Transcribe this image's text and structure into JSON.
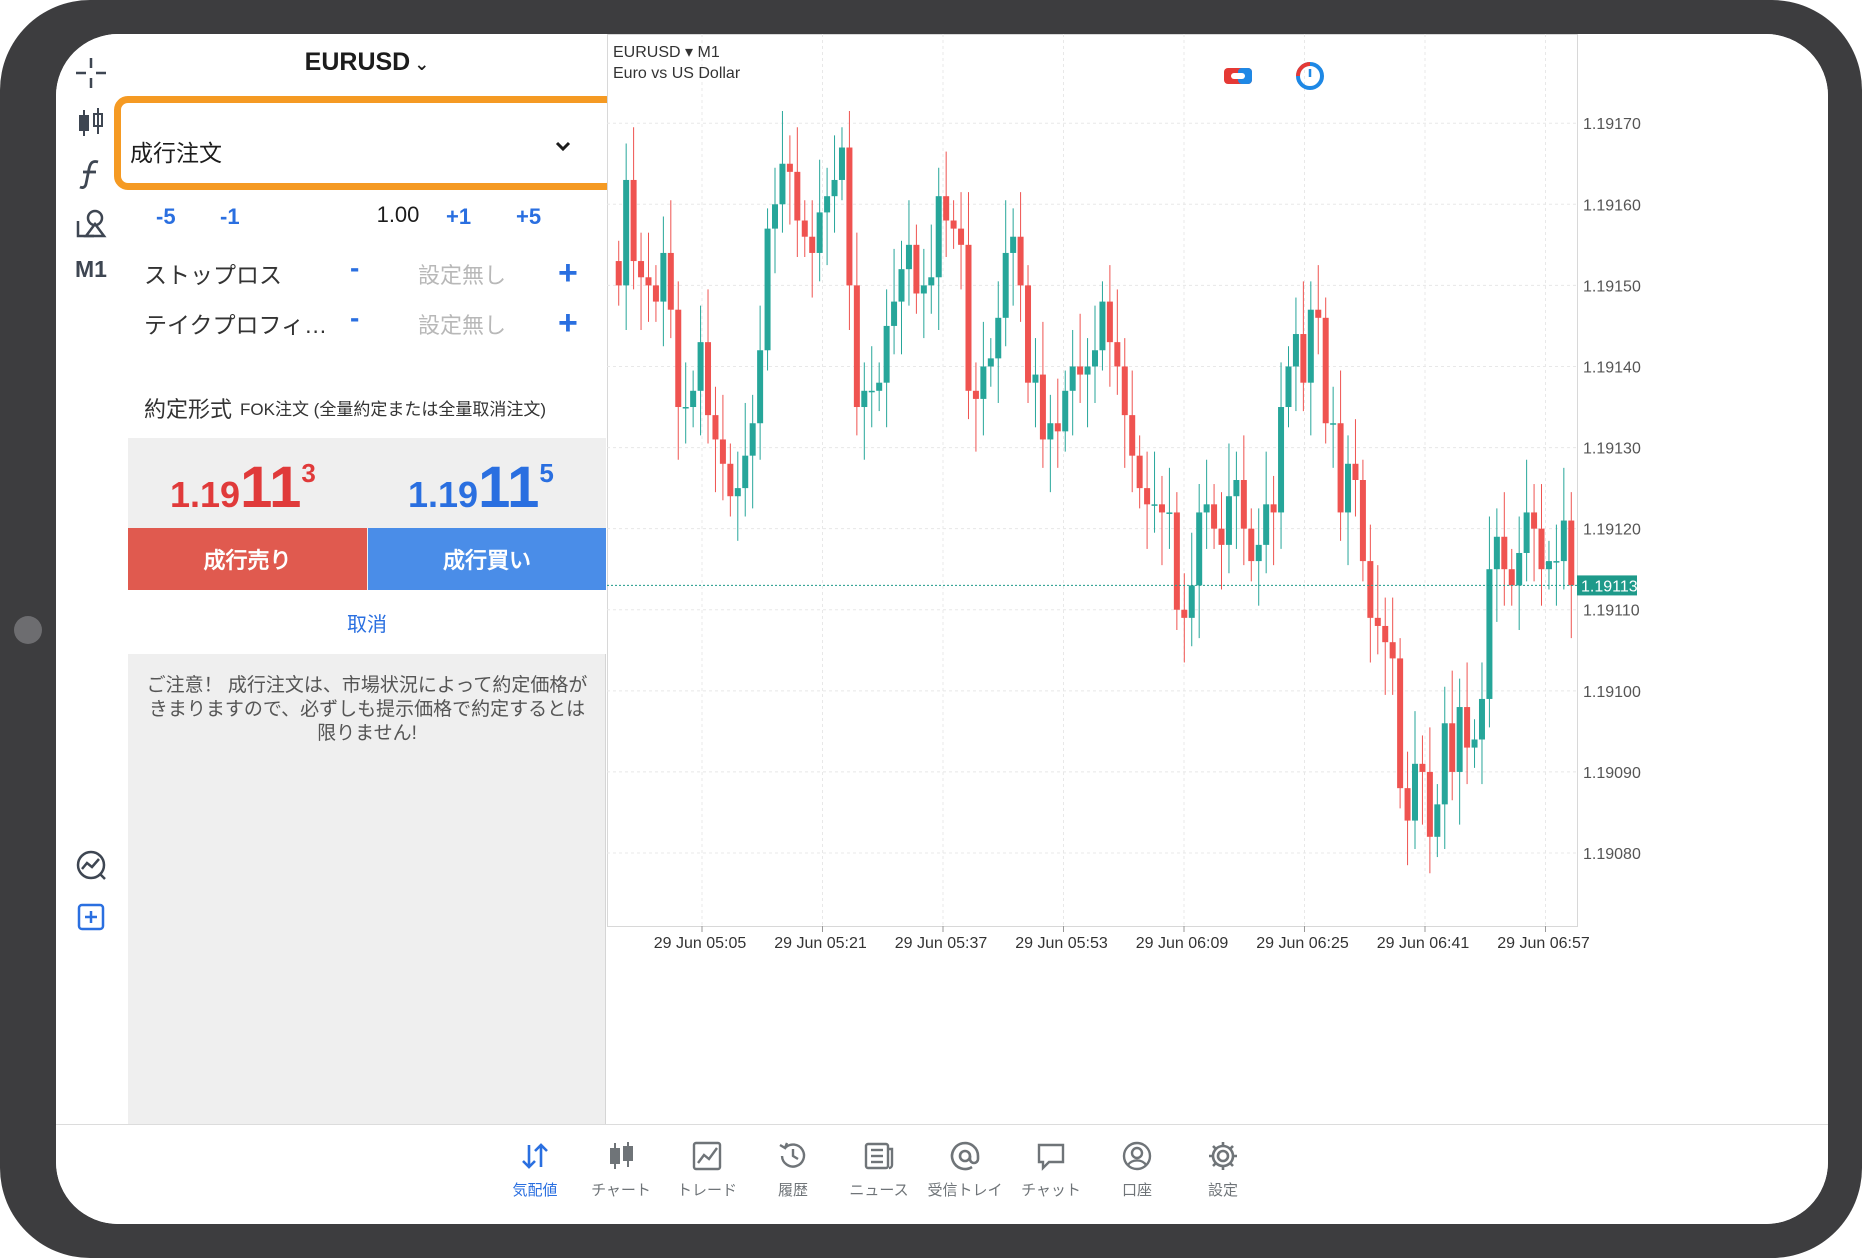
{
  "toolbar": {
    "timeframe": "M1"
  },
  "order": {
    "symbol": "EURUSD",
    "order_type": "成行注文",
    "volume_steps": [
      "-5",
      "-1",
      "+1",
      "+5"
    ],
    "volume": "1.00",
    "stop_loss_label": "ストップロス",
    "take_profit_label": "テイクプロフィ…",
    "minus": "-",
    "plus": "+",
    "not_set": "設定無し",
    "fill_label": "約定形式",
    "fill_value": "FOK注文 (全量約定または全量取消注文)",
    "bid": {
      "prefix": "1.19",
      "big": "11",
      "sup": "3"
    },
    "ask": {
      "prefix": "1.19",
      "big": "11",
      "sup": "5"
    },
    "sell_label": "成行売り",
    "buy_label": "成行買い",
    "cancel_label": "取消",
    "warning": "ご注意！ 成行注文は、市場状況によって約定価格がきまりますので、必ずしも提示価格で約定するとは限りません!"
  },
  "chart_header": {
    "symbol": "EURUSD ▾ M1",
    "description": "Euro vs US Dollar"
  },
  "chart_data": {
    "type": "candlestick",
    "symbol": "EURUSD",
    "timeframe": "M1",
    "y_ticks": [
      "1.19170",
      "1.19160",
      "1.19150",
      "1.19140",
      "1.19130",
      "1.19120",
      "1.19110",
      "1.19100",
      "1.19090",
      "1.19080"
    ],
    "ylim": [
      1.19071,
      1.19181
    ],
    "x_ticks": [
      "29 Jun 05:05",
      "29 Jun 05:21",
      "29 Jun 05:37",
      "29 Jun 05:53",
      "29 Jun 06:09",
      "29 Jun 06:25",
      "29 Jun 06:41",
      "29 Jun 06:57"
    ],
    "current_price": "1.19113",
    "colors": {
      "up": "#26a69a",
      "down": "#ef5350",
      "grid": "#e8e8e8",
      "price_line": "#1e9a8a"
    },
    "closes": [
      1.1915,
      1.19163,
      1.19153,
      1.19151,
      1.1915,
      1.19148,
      1.19154,
      1.19147,
      1.19135,
      1.19135,
      1.19137,
      1.19143,
      1.19134,
      1.19131,
      1.19128,
      1.19124,
      1.19125,
      1.19129,
      1.19133,
      1.19142,
      1.19157,
      1.1916,
      1.19165,
      1.19164,
      1.19158,
      1.19156,
      1.19154,
      1.19159,
      1.19161,
      1.19163,
      1.19167,
      1.1915,
      1.19135,
      1.19137,
      1.19137,
      1.19138,
      1.19145,
      1.19148,
      1.19152,
      1.19155,
      1.19149,
      1.1915,
      1.19151,
      1.19161,
      1.19158,
      1.19157,
      1.19155,
      1.19137,
      1.19136,
      1.1914,
      1.19141,
      1.19146,
      1.19154,
      1.19156,
      1.1915,
      1.19138,
      1.19139,
      1.19131,
      1.19133,
      1.19132,
      1.19137,
      1.1914,
      1.19139,
      1.1914,
      1.19142,
      1.19148,
      1.19143,
      1.1914,
      1.19134,
      1.19129,
      1.19125,
      1.19123,
      1.19123,
      1.19122,
      1.19122,
      1.1911,
      1.19109,
      1.19113,
      1.19122,
      1.19123,
      1.1912,
      1.19118,
      1.19124,
      1.19126,
      1.1912,
      1.19116,
      1.19118,
      1.19123,
      1.19122,
      1.19135,
      1.1914,
      1.19144,
      1.19138,
      1.19147,
      1.19146,
      1.19133,
      1.19133,
      1.19122,
      1.19128,
      1.19126,
      1.19116,
      1.19109,
      1.19108,
      1.19106,
      1.19104,
      1.19088,
      1.19084,
      1.19091,
      1.1909,
      1.19082,
      1.19086,
      1.19096,
      1.1909,
      1.19098,
      1.19093,
      1.19094,
      1.19099,
      1.19115,
      1.19119,
      1.19115,
      1.19113,
      1.19117,
      1.19122,
      1.1912,
      1.19115,
      1.19116,
      1.19116,
      1.19121,
      1.19113
    ]
  },
  "nav": {
    "items": [
      "気配値",
      "チャート",
      "トレード",
      "履歴",
      "ニュース",
      "受信トレイ",
      "チャット",
      "口座",
      "設定"
    ]
  }
}
